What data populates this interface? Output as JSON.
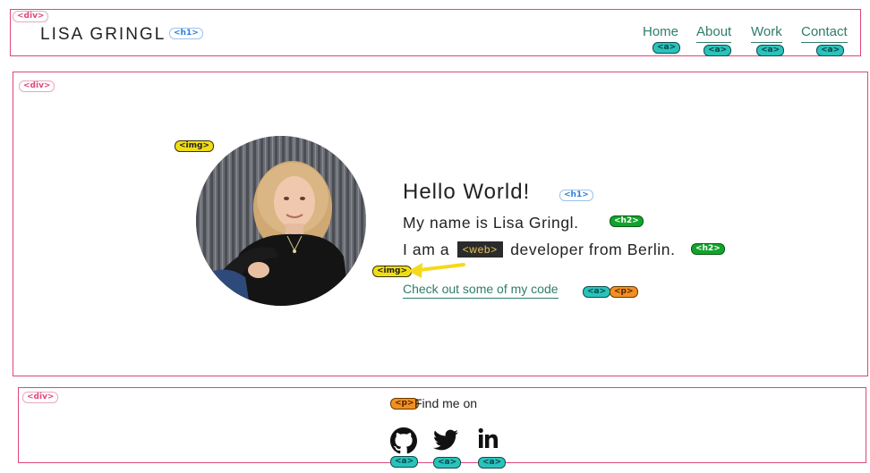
{
  "header": {
    "logo": "LISA GRINGL",
    "nav": [
      {
        "label": "Home"
      },
      {
        "label": "About"
      },
      {
        "label": "Work"
      },
      {
        "label": "Contact"
      }
    ]
  },
  "hero": {
    "greeting": "Hello World!",
    "name_line": "My name is Lisa Gringl.",
    "role_prefix": "I am a",
    "role_badge": "<web>",
    "role_suffix": "developer from Berlin.",
    "code_link": "Check out some of my code"
  },
  "footer": {
    "find_me": "Find me on",
    "socials": [
      {
        "icon": "github-icon"
      },
      {
        "icon": "twitter-icon"
      },
      {
        "icon": "linkedin-icon"
      }
    ]
  },
  "tags": {
    "div": "<div>",
    "h1": "<h1>",
    "h2": "<h2>",
    "a": "<a>",
    "p": "<p>",
    "img": "<img>"
  },
  "colors": {
    "outline": "#e0457b",
    "link": "#2e7d6b",
    "tag_a": "#29c3bc",
    "tag_h2": "#12a32c",
    "tag_img": "#f1dd16",
    "tag_p": "#f19022",
    "tag_h1": "#2a7fd8"
  }
}
